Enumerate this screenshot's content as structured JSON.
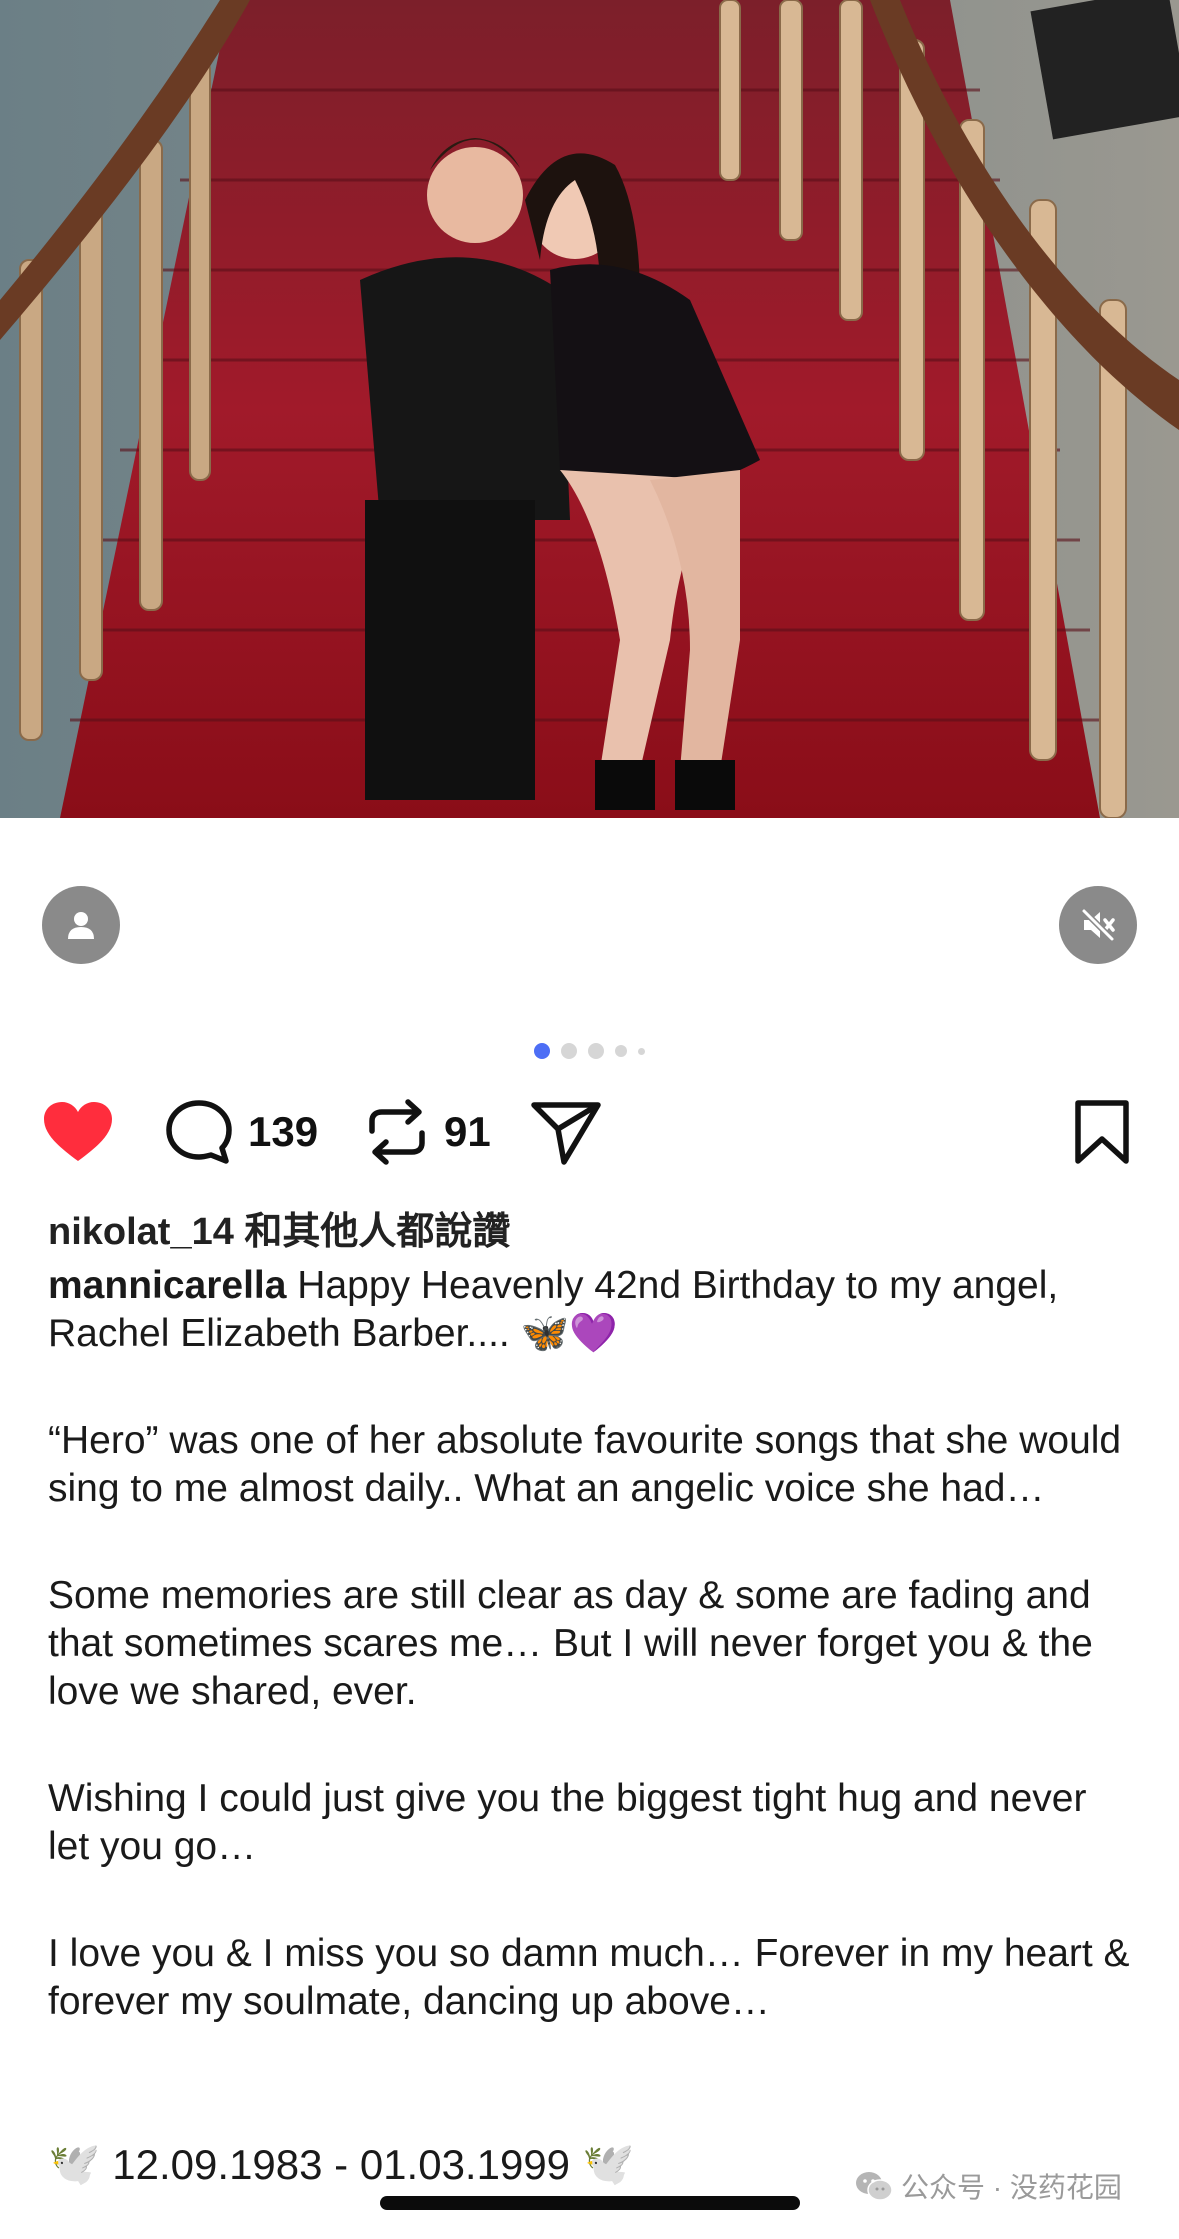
{
  "post": {
    "media": {
      "page_count": 5,
      "current_page": 1
    },
    "actions": {
      "comments_count": "139",
      "reposts_count": "91",
      "liked": true
    },
    "likes_text": "nikolat_14 和其他人都說讚",
    "caption": {
      "username": "mannicarella",
      "first_line": " Happy Heavenly 42nd Birthday to my angel, Rachel Elizabeth Barber.... 🦋💜",
      "paragraphs": [
        "“Hero” was one of her absolute favourite songs that she would sing to me almost daily.. What an angelic voice she had…",
        "Some memories are still clear as day & some are fading and that sometimes scares me… But I will never forget you & the love we shared, ever.",
        "Wishing I could just give you the biggest tight hug and never let you go…",
        "I love you & I miss you so damn much… Forever in my heart & forever my soulmate, dancing up above…"
      ],
      "dates": "12.09.1983 - 01.03.1999",
      "dove_emoji": "🕊️"
    }
  },
  "watermark": {
    "text": "公众号 · 没药花园",
    "icon": "wechat-icon"
  },
  "colors": {
    "like_red": "#ff2d3d",
    "active_dot": "#4d6ef5",
    "text": "#111111",
    "overlay_button": "#8a8a8a"
  }
}
